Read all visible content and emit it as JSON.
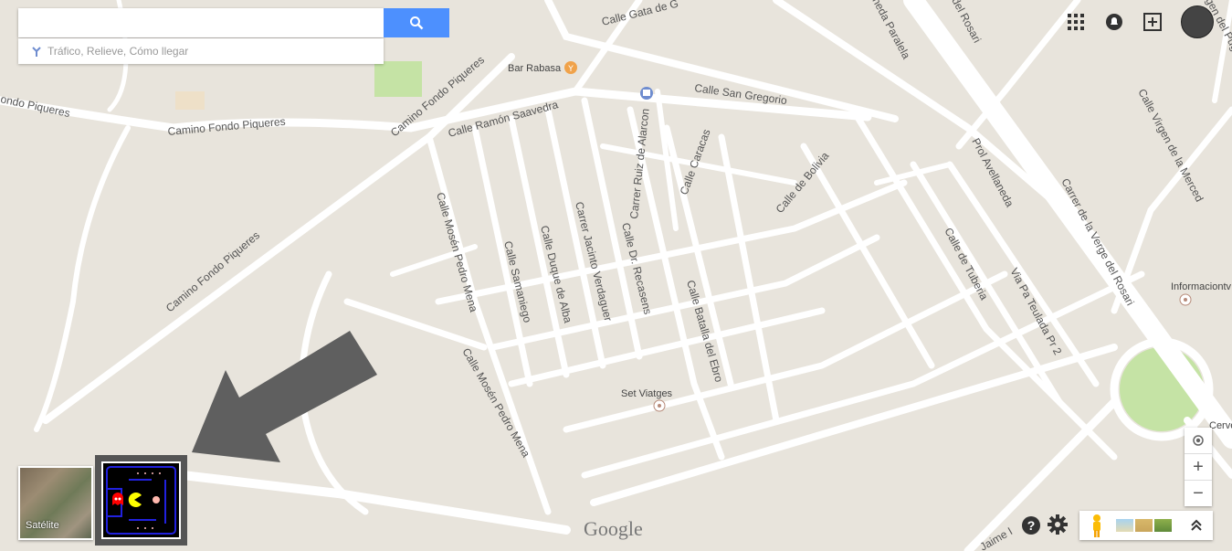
{
  "search": {
    "placeholder": "",
    "hint": "Tráfico, Relieve, Cómo llegar"
  },
  "streets": {
    "calle_gata": "Calle Gata de G",
    "san_gregorio": "Calle San Gregorio",
    "ramon_saavedra": "Calle Ramón Saavedra",
    "camino_fondo_piqueres_a": "Camino Fondo Piqueres",
    "camino_fondo_piqueres_b": "Camino Fondo Piqueres",
    "camino_fondo_piqueres_c": "Camino Fondo Piqueres",
    "fondo_piqueres_left": "ondo Piqueres",
    "mosen_pedro_mena_a": "Calle Mosén Pedro Mena",
    "mosen_pedro_mena_b": "Calle Mosén Pedro Mena",
    "samaniego": "Calle Samaniego",
    "duque_alba": "Calle Duque de Alba",
    "jacinto_verdaguer": "Carrer Jacinto Verdaguer",
    "recasens": "Calle Dr. Recasens",
    "ruiz_alarcon": "Carrer Ruiz de Alarcon",
    "caracas": "Calle Caracas",
    "bolivia": "Calle de Bolivia",
    "batalla_ebro": "Calle Batalla del Ebro",
    "avellaneda": "Prol Avellaneda",
    "tuberia": "Calle de Tuberia",
    "teulada": "Via Pa Teulada Pr 2",
    "vierge_rosari": "Carrer de la Verge del Rosari",
    "virgen_merced": "Calle Virgen de la Merced",
    "del_rosari": "del Rosari",
    "neda_paralela": "neda Paralela",
    "gen_del_pug": "gen del Pug",
    "jaime": "Jaime I"
  },
  "pois": {
    "bar_rabasa": "Bar Rabasa",
    "set_viatges": "Set Viatges",
    "informacion": "Informaciontv",
    "cerve": "Cerve"
  },
  "map_type": {
    "satellite_label": "Satélite"
  },
  "brand": {
    "google": "Google"
  },
  "controls": {
    "zoom_in": "+",
    "zoom_out": "−",
    "help": "?"
  },
  "colors": {
    "search_button": "#4d90fe",
    "map_bg": "#e8e4dc",
    "road": "#ffffff",
    "park": "#c5e3a5",
    "arrow": "#5f5f5f"
  }
}
